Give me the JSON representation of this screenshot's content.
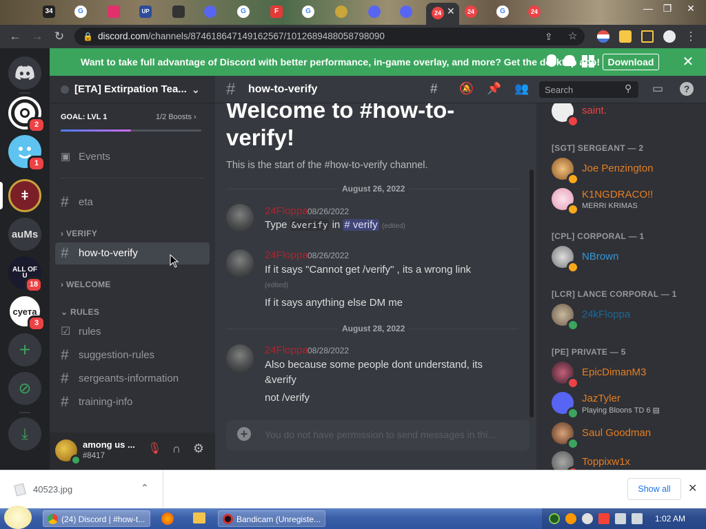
{
  "browser": {
    "tab_icon_labels": [
      "34",
      "G",
      "UP",
      "G",
      "F",
      "G",
      "24",
      "24",
      "G",
      "24"
    ],
    "url_host": "discord.com",
    "url_path": "/channels/874618647149162567/1012689488058798090"
  },
  "banner": {
    "text": "Want to take full advantage of Discord with better performance, in-game overlay, and more? Get the desktop app!",
    "download_label": "Download"
  },
  "servers": [
    {
      "label": "",
      "badge": "2"
    },
    {
      "label": "",
      "badge": "1"
    },
    {
      "label": "",
      "badge": ""
    },
    {
      "label": "auMs",
      "badge": ""
    },
    {
      "label": "ALL OF U",
      "badge": "18"
    },
    {
      "label": "суета",
      "badge": "3"
    }
  ],
  "guild": {
    "name": "[ETA] Extirpation Tea...",
    "goal_label": "GOAL: LVL 1",
    "boosts": "1/2 Boosts",
    "boost_progress": 0.5,
    "events_label": "Events"
  },
  "channels": {
    "eta": "eta",
    "cat_verify": "VERIFY",
    "how_to_verify": "how-to-verify",
    "cat_welcome": "WELCOME",
    "cat_rules": "RULES",
    "rules": "rules",
    "suggestion_rules": "suggestion-rules",
    "sergeants_information": "sergeants-information",
    "training_info": "training-info"
  },
  "user": {
    "name": "among us ...",
    "tag": "#8417"
  },
  "chat_header": {
    "channel": "how-to-verify",
    "search_placeholder": "Search"
  },
  "chat": {
    "welcome_title_1": "Welcome to #how-to-",
    "welcome_title_2": "verify!",
    "welcome_sub": "This is the start of the #how-to-verify channel.",
    "date1": "August 26, 2022",
    "date2": "August 28, 2022",
    "messages": [
      {
        "author": "24Floppa",
        "time": "08/26/2022",
        "pre": "Type",
        "code": "&verify",
        "mid": "in",
        "mention": "# verify",
        "edited": "(edited)"
      },
      {
        "author": "24Floppa",
        "time": "08/26/2022",
        "line1": "If it says \"Cannot get /verify\" ,  its a wrong link",
        "edited": "(edited)",
        "line2": "If it says anything else DM me"
      },
      {
        "author": "24Floppa",
        "time": "08/28/2022",
        "line1": "Also because some people dont understand, its",
        "line2": "&verify",
        "line3": "not /verify"
      }
    ],
    "input_placeholder": "You do not have permission to send messages in thi..."
  },
  "members": {
    "top_member": "saint.",
    "groups": [
      {
        "role": "[SGT] SERGEANT — 2",
        "members": [
          {
            "name": "Joe Penzington",
            "color": "#e67e22"
          },
          {
            "name": "K1NGDRACO!!",
            "sub": "MERRI KRIMAS",
            "color": "#e67e22"
          }
        ]
      },
      {
        "role": "[CPL] CORPORAL — 1",
        "members": [
          {
            "name": "NBrown",
            "color": "#3498db"
          }
        ]
      },
      {
        "role": "[LCR] LANCE CORPORAL — 1",
        "members": [
          {
            "name": "24kFloppa",
            "color": "#206694"
          }
        ]
      },
      {
        "role": "[PE] PRIVATE — 5",
        "members": [
          {
            "name": "EpicDimanM3",
            "color": "#e67e22"
          },
          {
            "name": "JazTyler",
            "sub": "Playing Bloons TD 6",
            "color": "#e67e22"
          },
          {
            "name": "Saul Goodman",
            "color": "#e67e22"
          },
          {
            "name": "Toppixw1x",
            "color": "#e67e22"
          }
        ]
      }
    ]
  },
  "downloads": {
    "file": "40523.jpg",
    "show_all": "Show all"
  },
  "taskbar": {
    "task1": "(24) Discord | #how-t...",
    "task2": "Bandicam (Unregiste...",
    "clock": "1:02 AM"
  },
  "colors": {
    "banner_green": "#3ba55d",
    "author_red": "#b3222f",
    "online_green": "#3ba55d",
    "dnd_red": "#ed4245",
    "idle_yellow": "#faa81a"
  }
}
